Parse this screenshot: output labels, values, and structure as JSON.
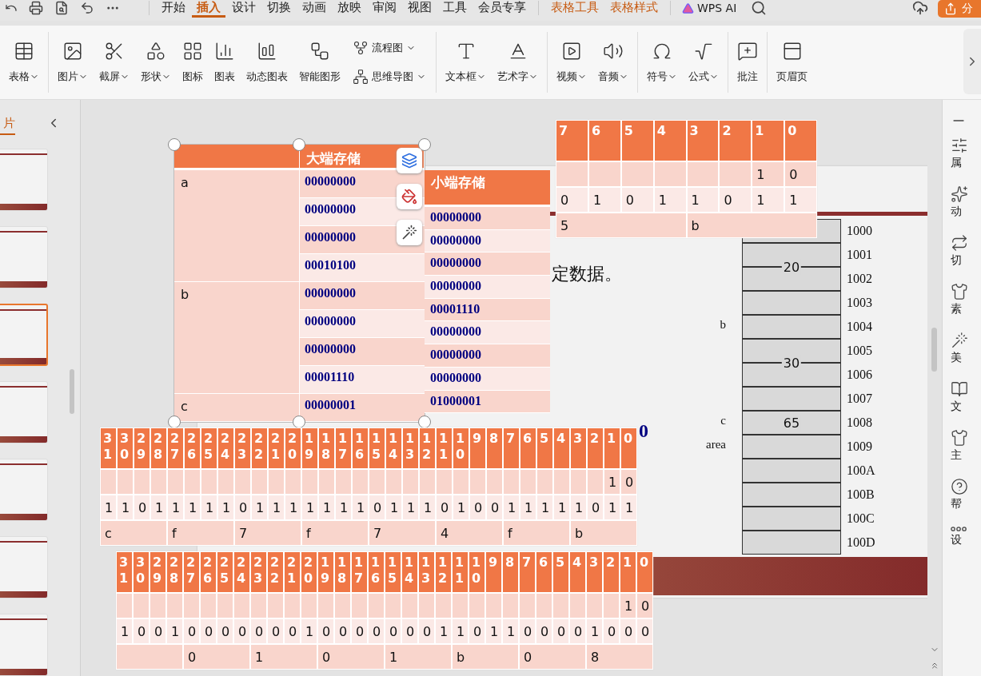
{
  "toolbar": {
    "tabs": [
      {
        "label": "开始",
        "selected": false,
        "kind": "main"
      },
      {
        "label": "插入",
        "selected": true,
        "kind": "main"
      },
      {
        "label": "设计",
        "selected": false,
        "kind": "main"
      },
      {
        "label": "切换",
        "selected": false,
        "kind": "main"
      },
      {
        "label": "动画",
        "selected": false,
        "kind": "main"
      },
      {
        "label": "放映",
        "selected": false,
        "kind": "main"
      },
      {
        "label": "审阅",
        "selected": false,
        "kind": "main"
      },
      {
        "label": "视图",
        "selected": false,
        "kind": "main"
      },
      {
        "label": "工具",
        "selected": false,
        "kind": "main"
      },
      {
        "label": "会员专享",
        "selected": false,
        "kind": "main"
      },
      {
        "label": "表格工具",
        "selected": false,
        "kind": "context"
      },
      {
        "label": "表格样式",
        "selected": false,
        "kind": "context"
      }
    ],
    "ai_label": "WPS AI",
    "share_label": "分"
  },
  "ribbon": {
    "groups": [
      {
        "items": [
          {
            "kind": "button",
            "label": "表格",
            "dropdown": true
          }
        ]
      },
      {
        "items": [
          {
            "kind": "button",
            "label": "图片",
            "dropdown": true
          },
          {
            "kind": "button",
            "label": "截屏",
            "dropdown": true
          },
          {
            "kind": "button",
            "label": "形状",
            "dropdown": true
          },
          {
            "kind": "button",
            "label": "图标",
            "dropdown": false
          },
          {
            "kind": "button",
            "label": "图表",
            "dropdown": false
          },
          {
            "kind": "button",
            "label": "动态图表",
            "dropdown": false
          },
          {
            "kind": "button",
            "label": "智能图形",
            "dropdown": false
          },
          {
            "kind": "stack",
            "items": [
              {
                "label": "流程图",
                "dropdown": true
              },
              {
                "label": "思维导图",
                "dropdown": true
              }
            ]
          }
        ]
      },
      {
        "items": [
          {
            "kind": "button",
            "label": "文本框",
            "dropdown": true
          },
          {
            "kind": "button",
            "label": "艺术字",
            "dropdown": true
          }
        ]
      },
      {
        "items": [
          {
            "kind": "button",
            "label": "视频",
            "dropdown": true
          },
          {
            "kind": "button",
            "label": "音频",
            "dropdown": true
          }
        ]
      },
      {
        "items": [
          {
            "kind": "button",
            "label": "符号",
            "dropdown": true
          },
          {
            "kind": "button",
            "label": "公式",
            "dropdown": true
          }
        ]
      },
      {
        "items": [
          {
            "kind": "button",
            "label": "批注",
            "dropdown": false
          }
        ]
      },
      {
        "items": [
          {
            "kind": "button",
            "label": "页眉页",
            "dropdown": false
          }
        ]
      }
    ]
  },
  "slide_panel": {
    "title": "片",
    "thumbnails": [
      {
        "selected": false
      },
      {
        "selected": false
      },
      {
        "selected": true
      },
      {
        "selected": false
      },
      {
        "selected": false
      },
      {
        "selected": false
      },
      {
        "selected": false
      }
    ]
  },
  "canvas": {
    "slide": {
      "text": "定数据。",
      "binary_fragment": "0",
      "memory": [
        {
          "value": "20",
          "cells": [
            "1000",
            "1001",
            "1002",
            "1003"
          ]
        },
        {
          "label": "b",
          "value": "30",
          "cells": [
            "1004",
            "1005",
            "1006",
            "1007"
          ]
        },
        {
          "label": "c",
          "value": "65",
          "cells": [
            "1008"
          ]
        },
        {
          "label": "area",
          "cells": [
            "1009",
            "100A",
            "100B",
            "100C",
            "100D"
          ]
        }
      ]
    },
    "endian_table": {
      "selected": true,
      "header": "大端存储",
      "groups": [
        {
          "label": "a",
          "bytes": [
            "00000000",
            "00000000",
            "00000000",
            "00010100"
          ]
        },
        {
          "label": "b",
          "bytes": [
            "00000000",
            "00000000",
            "00000000",
            "00001110"
          ]
        },
        {
          "label": "c",
          "bytes": [
            "00000001"
          ]
        }
      ]
    },
    "little_endian_table": {
      "header": "小端存储",
      "bytes": [
        "00000000",
        "00000000",
        "00000000",
        "00000000",
        "00001110",
        "00000000",
        "00000000",
        "00000000",
        "01000001"
      ]
    },
    "bit_tables": [
      {
        "header": [
          "7",
          "6",
          "5",
          "4",
          "3",
          "2",
          "1",
          "0"
        ],
        "tail": [
          "1",
          "0"
        ],
        "bits": [
          "0",
          "1",
          "0",
          "1",
          "1",
          "0",
          "1",
          "1"
        ],
        "nibbles": [
          "5",
          "b"
        ]
      },
      {
        "header": [
          "31",
          "30",
          "29",
          "28",
          "27",
          "26",
          "25",
          "24",
          "23",
          "22",
          "21",
          "20",
          "19",
          "18",
          "17",
          "16",
          "15",
          "14",
          "13",
          "12",
          "11",
          "10",
          "9",
          "8",
          "7",
          "6",
          "5",
          "4",
          "3",
          "2",
          "1",
          "0"
        ],
        "tail": [
          "1",
          "0"
        ],
        "bits": [
          "1",
          "1",
          "0",
          "1",
          "1",
          "1",
          "1",
          "1",
          "0",
          "1",
          "1",
          "1",
          "1",
          "1",
          "1",
          "1",
          "0",
          "1",
          "1",
          "1",
          "0",
          "1",
          "0",
          "0",
          "1",
          "1",
          "1",
          "1",
          "1",
          "0",
          "1",
          "1"
        ],
        "nibbles": [
          "c",
          "f",
          "7",
          "f",
          "7",
          "4",
          "f",
          "b"
        ],
        "blank_first_nibble": false
      },
      {
        "header": [
          "31",
          "30",
          "29",
          "28",
          "27",
          "26",
          "25",
          "24",
          "23",
          "22",
          "21",
          "20",
          "19",
          "18",
          "17",
          "16",
          "15",
          "14",
          "13",
          "12",
          "11",
          "10",
          "9",
          "8",
          "7",
          "6",
          "5",
          "4",
          "3",
          "2",
          "1",
          "0"
        ],
        "tail": [
          "1",
          "0"
        ],
        "bits": [
          "1",
          "0",
          "0",
          "1",
          "0",
          "0",
          "0",
          "0",
          "0",
          "0",
          "0",
          "1",
          "0",
          "0",
          "0",
          "0",
          "0",
          "0",
          "0",
          "1",
          "1",
          "0",
          "1",
          "1",
          "0",
          "0",
          "0",
          "0",
          "1",
          "0",
          "0",
          "0"
        ],
        "nibbles": [
          "0",
          "1",
          "0",
          "1",
          "b",
          "0",
          "8"
        ],
        "blank_first_nibble": true
      }
    ]
  },
  "sidebar": {
    "labels": [
      "属",
      "动",
      "切",
      "素",
      "美",
      "文",
      "主",
      "帮",
      "设"
    ]
  }
}
